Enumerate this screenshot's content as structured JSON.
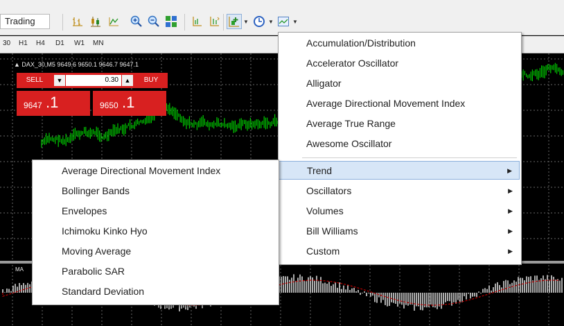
{
  "toolbar": {
    "account_label": "Trading",
    "icons": [
      "bar-chart-icon",
      "candlestick-icon",
      "line-chart-icon",
      "zoom-in-icon",
      "zoom-out-icon",
      "tile-windows-icon",
      "chart-shift-icon",
      "autoscroll-icon",
      "indicators-icon",
      "periods-icon",
      "templates-icon"
    ]
  },
  "timeframes": [
    "30",
    "H1",
    "H4",
    "D1",
    "W1",
    "MN"
  ],
  "chart": {
    "info": "▲ DAX_30,M5  9649.6 9650.1 9646.7 9647.1",
    "macd_label": "MA",
    "colors": {
      "up": "#00cc00",
      "signal": "#cc0000",
      "grid": "#6a6a6a"
    }
  },
  "trade": {
    "sell_label": "SELL",
    "buy_label": "BUY",
    "volume": "0.30",
    "sell_prefix": "9647",
    "sell_suffix": ".1",
    "buy_prefix": "9650",
    "buy_suffix": ".1"
  },
  "indicators_menu": {
    "items": [
      "Accumulation/Distribution",
      "Accelerator Oscillator",
      "Alligator",
      "Average Directional Movement Index",
      "Average True Range",
      "Awesome Oscillator"
    ],
    "categories": [
      {
        "label": "Trend",
        "highlighted": true
      },
      {
        "label": "Oscillators"
      },
      {
        "label": "Volumes"
      },
      {
        "label": "Bill Williams"
      },
      {
        "label": "Custom"
      }
    ]
  },
  "trend_submenu": {
    "items": [
      "Average Directional Movement Index",
      "Bollinger Bands",
      "Envelopes",
      "Ichimoku Kinko Hyo",
      "Moving Average",
      "Parabolic SAR",
      "Standard Deviation"
    ]
  }
}
